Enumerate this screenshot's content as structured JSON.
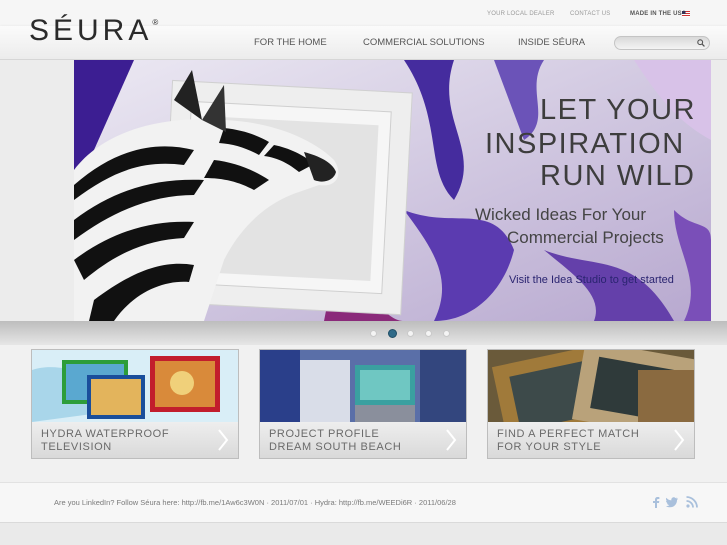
{
  "brand": {
    "logo_text": "SÉURA",
    "logo_mark": "®"
  },
  "top_links": [
    "YOUR LOCAL DEALER",
    "CONTACT US",
    "MADE IN THE USA"
  ],
  "nav": [
    "FOR THE HOME",
    "COMMERCIAL SOLUTIONS",
    "INSIDE SÉURA"
  ],
  "search": {
    "placeholder": "",
    "icon": "search-icon"
  },
  "hero": {
    "headline": [
      "LET YOUR",
      "INSPIRATION",
      "RUN WILD"
    ],
    "subheadline": [
      "Wicked Ideas For Your",
      "Commercial Projects"
    ],
    "cta": "Visit the Idea Studio to get started"
  },
  "carousel": {
    "count": 5,
    "active": 2
  },
  "promos": [
    {
      "line1": "HYDRA WATERPROOF",
      "line2": "TELEVISION"
    },
    {
      "line1": "PROJECT PROFILE",
      "line2": "DREAM SOUTH BEACH"
    },
    {
      "line1": "FIND A PERFECT MATCH",
      "line2": "FOR YOUR STYLE"
    }
  ],
  "footer": {
    "tweet": "Are you LinkedIn? Follow Séura here: http://fb.me/1Aw6c3W0N · 2011/07/01 · Hydra: http://fb.me/WEEDi6R · 2011/06/28",
    "social": [
      "facebook-icon",
      "twitter-icon",
      "rss-icon"
    ]
  },
  "colors": {
    "accent": "#2f6a88",
    "text": "#555555"
  }
}
